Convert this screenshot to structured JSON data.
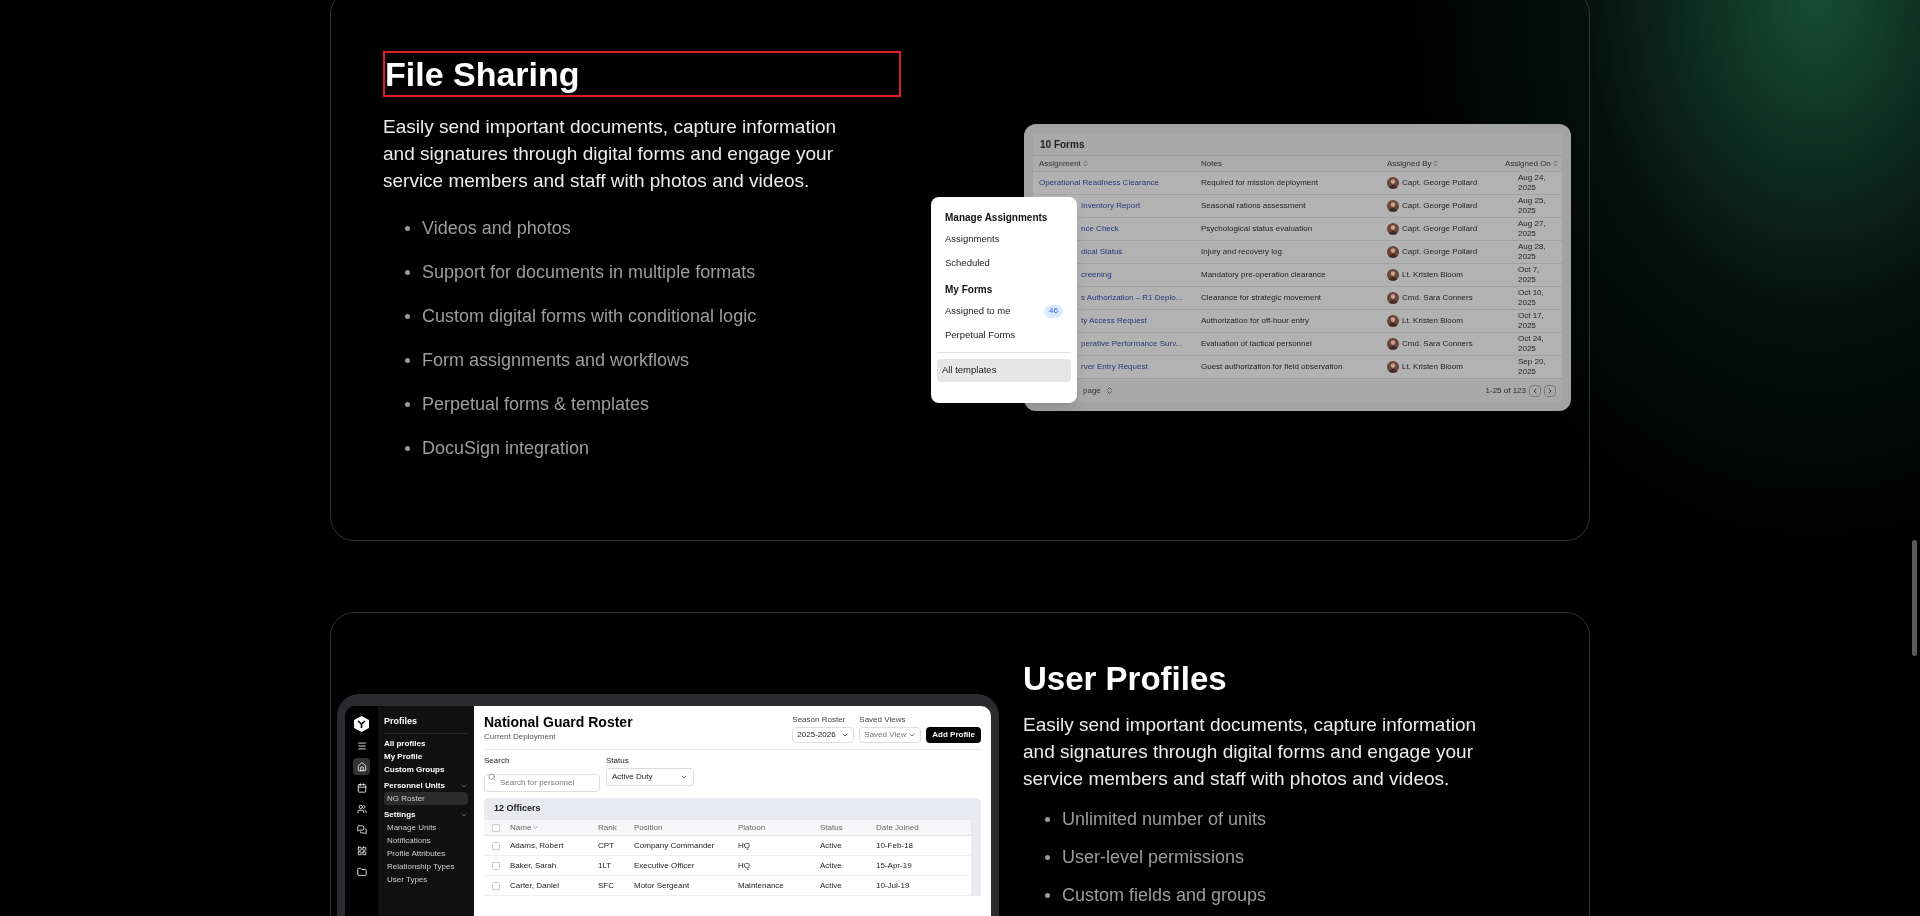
{
  "file_sharing": {
    "title": "File Sharing",
    "outlined": true,
    "description": "Easily send important documents, capture information and signatures through digital forms and engage your service members and staff with photos and videos.",
    "features": [
      "Videos and photos",
      "Support for documents in multiple formats",
      "Custom digital forms with conditional logic",
      "Form assignments and workflows",
      "Perpetual forms & templates",
      "DocuSign integration"
    ],
    "menu": {
      "sections": [
        {
          "heading": "Manage Assignments",
          "items": [
            {
              "label": "Assignments",
              "selected": false
            },
            {
              "label": "Scheduled",
              "selected": false
            }
          ]
        },
        {
          "heading": "My Forms",
          "items": [
            {
              "label": "Assigned to me",
              "badge": "46",
              "selected": false
            },
            {
              "label": "Perpetual Forms",
              "selected": false
            }
          ]
        }
      ],
      "footer_item": {
        "label": "All templates",
        "selected": true
      }
    },
    "table": {
      "title": "10 Forms",
      "columns": [
        "Assignment",
        "Notes",
        "Assigned By",
        "Assigned On"
      ],
      "rows": [
        {
          "assignment": "Operational Readiness Clearance",
          "notes": "Required for mission deployment",
          "assigned_by": "Capt. George Pollard",
          "assigned_on": "Aug 24, 2025"
        },
        {
          "assignment": "Inventory Report",
          "notes": "Seasonal rations assessment",
          "assigned_by": "Capt. George Pollard",
          "assigned_on": "Aug 25, 2025"
        },
        {
          "assignment": "nce Check",
          "notes": "Psychological status evaluation",
          "assigned_by": "Capt. George Pollard",
          "assigned_on": "Aug 27, 2025"
        },
        {
          "assignment": "dical Status",
          "notes": "Injury and recovery log",
          "assigned_by": "Capt. George Pollard",
          "assigned_on": "Aug 28, 2025"
        },
        {
          "assignment": "creening",
          "notes": "Mandatory pre-operation clearance",
          "assigned_by": "Lt. Kristen Bloom",
          "assigned_on": "Oct 7, 2025"
        },
        {
          "assignment": "s Authorization – R1 Deplo...",
          "notes": "Clearance for strategic movement",
          "assigned_by": "Cmd. Sara Conners",
          "assigned_on": "Oct 10, 2025"
        },
        {
          "assignment": "ty Access Request",
          "notes": "Authorization for off-hour entry",
          "assigned_by": "Lt. Kristen Bloom",
          "assigned_on": "Oct 17, 2025"
        },
        {
          "assignment": "perative Performance Surv...",
          "notes": "Evaluation of tactical personnel",
          "assigned_by": "Cmd. Sara Conners",
          "assigned_on": "Oct 24, 2025"
        },
        {
          "assignment": "rver Entry Request",
          "notes": "Guest authorization for field observation",
          "assigned_by": "Lt. Kristen Bloom",
          "assigned_on": "Sep 20, 2025"
        }
      ],
      "footer_left": "page",
      "range": "1-25 of 123"
    }
  },
  "user_profiles": {
    "title": "User Profiles",
    "description": "Easily send important documents, capture information and signatures through digital forms and engage your service members and staff with photos and videos.",
    "features": [
      "Unlimited number of units",
      "User-level permissions",
      "Custom fields and groups"
    ],
    "app": {
      "rail": [
        {
          "kind": "menu",
          "selected": false
        },
        {
          "kind": "home",
          "selected": true
        },
        {
          "kind": "calendar",
          "selected": false
        },
        {
          "kind": "users",
          "selected": false
        },
        {
          "kind": "chat",
          "selected": false
        },
        {
          "kind": "table",
          "selected": false
        },
        {
          "kind": "folder",
          "selected": false
        }
      ],
      "sidebar": {
        "title": "Profiles",
        "links": [
          "All profiles",
          "My Profile",
          "Custom Groups"
        ],
        "groups": [
          {
            "label": "Personnel Units",
            "expanded": true,
            "children": [
              {
                "label": "NG Roster",
                "selected": true
              }
            ]
          },
          {
            "label": "Settings",
            "expanded": true,
            "children": [
              {
                "label": "Manage Units",
                "selected": false
              },
              {
                "label": "Notifications",
                "selected": false
              },
              {
                "label": "Profile Attributes",
                "selected": false
              },
              {
                "label": "Relationship Types",
                "selected": false
              },
              {
                "label": "User Types",
                "selected": false
              }
            ]
          }
        ]
      },
      "title": "National Guard Roster",
      "subtitle": "Current Deployment",
      "season": {
        "label": "Season Roster",
        "value": "2025-2026"
      },
      "views": {
        "label": "Saved Views",
        "placeholder": "Saved View"
      },
      "add_button": "Add Profile",
      "search": {
        "label": "Search",
        "placeholder": "Search for personnel"
      },
      "status": {
        "label": "Status",
        "value": "Active Duty"
      },
      "table": {
        "title": "12 Officers",
        "all_checked": false,
        "columns": [
          "Name",
          "Rank",
          "Position",
          "Platoon",
          "Status",
          "Date Joined"
        ],
        "rows": [
          {
            "checked": false,
            "cells": [
              "Adams, Robert",
              "CPT",
              "Company Commander",
              "HQ",
              "Active",
              "10-Feb-18"
            ]
          },
          {
            "checked": false,
            "cells": [
              "Baker, Sarah",
              "1LT",
              "Executive Officer",
              "HQ",
              "Active",
              "15-Apr-19"
            ]
          },
          {
            "checked": false,
            "cells": [
              "Carter, Daniel",
              "SFC",
              "Motor Sergeant",
              "Maintenance",
              "Active",
              "10-Jul-19"
            ]
          }
        ]
      }
    }
  }
}
